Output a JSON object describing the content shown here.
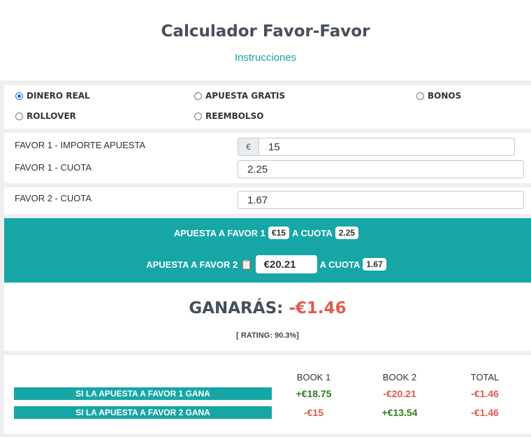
{
  "header": {
    "title": "Calculador Favor-Favor",
    "instructions": "Instrucciones"
  },
  "modes": [
    {
      "label": "DINERO REAL",
      "selected": true
    },
    {
      "label": "APUESTA GRATIS",
      "selected": false
    },
    {
      "label": "BONOS",
      "selected": false
    },
    {
      "label": "ROLLOVER",
      "selected": false
    },
    {
      "label": "REEMBOLSO",
      "selected": false
    }
  ],
  "favor1": {
    "stake_label": "FAVOR 1 - IMPORTE APUESTA",
    "currency": "€",
    "stake": "15",
    "odds_label": "FAVOR 1 - CUOTA",
    "odds": "2.25"
  },
  "favor2": {
    "odds_label": "FAVOR 2 - CUOTA",
    "odds": "1.67"
  },
  "summary": {
    "row1_prefix": "APUESTA A FAVOR 1",
    "row1_stake": "€15",
    "row1_mid": "A CUOTA",
    "row1_odds": "2.25",
    "row2_prefix": "APUESTA A FAVOR 2",
    "row2_stake": "€20.21",
    "row2_mid": "A CUOTA",
    "row2_odds": "1.67",
    "clip_icon": "📋"
  },
  "result": {
    "label": "GANARÁS:",
    "value": "-€1.46",
    "rating": "[ RATING: 90.3%]"
  },
  "table": {
    "headers": [
      "BOOK 1",
      "BOOK 2",
      "TOTAL"
    ],
    "rows": [
      {
        "label": "SI LA APUESTA A FAVOR 1 GANA",
        "book1": "+€18.75",
        "book2": "-€20.21",
        "total": "-€1.46"
      },
      {
        "label": "SI LA APUESTA A FAVOR 2 GANA",
        "book1": "-€15",
        "book2": "+€13.54",
        "total": "-€1.46"
      }
    ]
  },
  "colors": {
    "accent": "#17a6a6",
    "positive": "#2e7d1e",
    "negative": "#e05a4f",
    "radio": "#1a73e8"
  }
}
